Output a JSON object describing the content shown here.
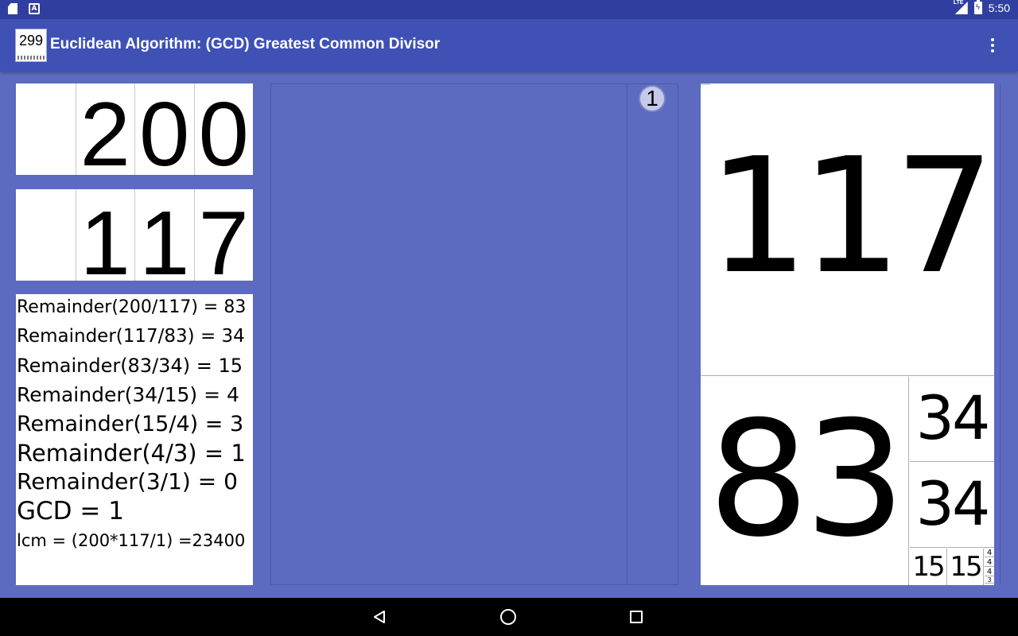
{
  "status_bar": {
    "network_label": "LTE",
    "time": "5:50",
    "icons": [
      "sd-card-icon",
      "notification-a-icon",
      "lte-signal-icon",
      "battery-charging-icon"
    ]
  },
  "app_bar": {
    "icon_text": "299",
    "title": "Euclidean Algorithm: (GCD) Greatest Common Divisor",
    "overflow_icon": "more-vert-icon"
  },
  "input_a": {
    "digits": [
      "",
      "2",
      "0",
      "0"
    ]
  },
  "input_b": {
    "digits": [
      "",
      "1",
      "1",
      "7"
    ]
  },
  "steps": {
    "lines": [
      "Remainder(200/117) = 83",
      "Remainder(117/83) = 34",
      "Remainder(83/34) = 15",
      "Remainder(34/15) = 4",
      "Remainder(15/4) = 3",
      "Remainder(4/3) = 1",
      "Remainder(3/1) = 0",
      "GCD = 1",
      "lcm = (200*117/1) =23400"
    ]
  },
  "middle_panel": {
    "step_badge": "1"
  },
  "right_panel": {
    "big": "117",
    "remainder_83": "83",
    "remainder_34_top": "34",
    "remainder_34_bottom": "34",
    "remainder_15_left": "15",
    "remainder_15_right": "15",
    "small_cells": [
      "4",
      "4",
      "4"
    ],
    "tiny_cell": "3"
  },
  "nav_bar": {
    "icons": [
      "back-icon",
      "home-icon",
      "recents-icon"
    ]
  },
  "colors": {
    "background": "#5c6bc0",
    "app_bar": "#3f51b5",
    "status_bar": "#303f9f",
    "nav_bar": "#000000"
  }
}
